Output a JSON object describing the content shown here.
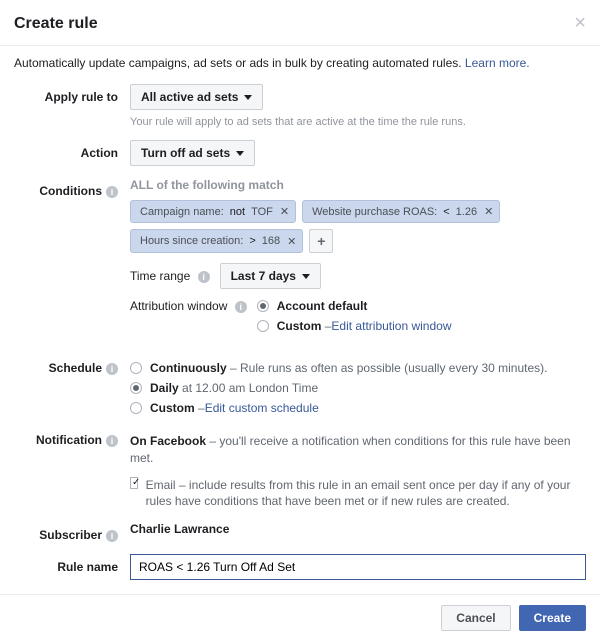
{
  "header": {
    "title": "Create rule"
  },
  "intro": {
    "text": "Automatically update campaigns, ad sets or ads in bulk by creating automated rules. ",
    "learn_more": "Learn more."
  },
  "apply_rule": {
    "label": "Apply rule to",
    "value": "All active ad sets",
    "helper": "Your rule will apply to ad sets that are active at the time the rule runs."
  },
  "action": {
    "label": "Action",
    "value": "Turn off ad sets"
  },
  "conditions": {
    "label": "Conditions",
    "header": "ALL of the following match",
    "chips": [
      {
        "field": "Campaign name:",
        "op": "not",
        "val": "TOF"
      },
      {
        "field": "Website purchase ROAS:",
        "op": "<",
        "val": "1.26"
      },
      {
        "field": "Hours since creation:",
        "op": ">",
        "val": "168"
      }
    ],
    "time_range": {
      "label": "Time range",
      "value": "Last 7 days"
    },
    "attribution": {
      "label": "Attribution window",
      "options": [
        {
          "label": "Account default",
          "checked": true
        },
        {
          "label": "Custom",
          "link": "Edit attribution window",
          "checked": false
        }
      ]
    }
  },
  "schedule": {
    "label": "Schedule",
    "options": [
      {
        "label": "Continuously",
        "desc": " – Rule runs as often as possible (usually every 30 minutes).",
        "checked": false
      },
      {
        "label": "Daily",
        "desc": " at 12.00 am London Time",
        "checked": true
      },
      {
        "label": "Custom",
        "link": "Edit custom schedule",
        "checked": false
      }
    ]
  },
  "notification": {
    "label": "Notification",
    "on_fb_label": "On Facebook",
    "on_fb_desc": " – you'll receive a notification when conditions for this rule have been met.",
    "email_label": "Email",
    "email_desc": " – include results from this rule in an email sent once per day if any of your rules have conditions that have been met or if new rules are created.",
    "email_checked": true
  },
  "subscriber": {
    "label": "Subscriber",
    "name": "Charlie Lawrance"
  },
  "rule_name": {
    "label": "Rule name",
    "value": "ROAS < 1.26 Turn Off Ad Set"
  },
  "footer": {
    "cancel": "Cancel",
    "create": "Create"
  }
}
